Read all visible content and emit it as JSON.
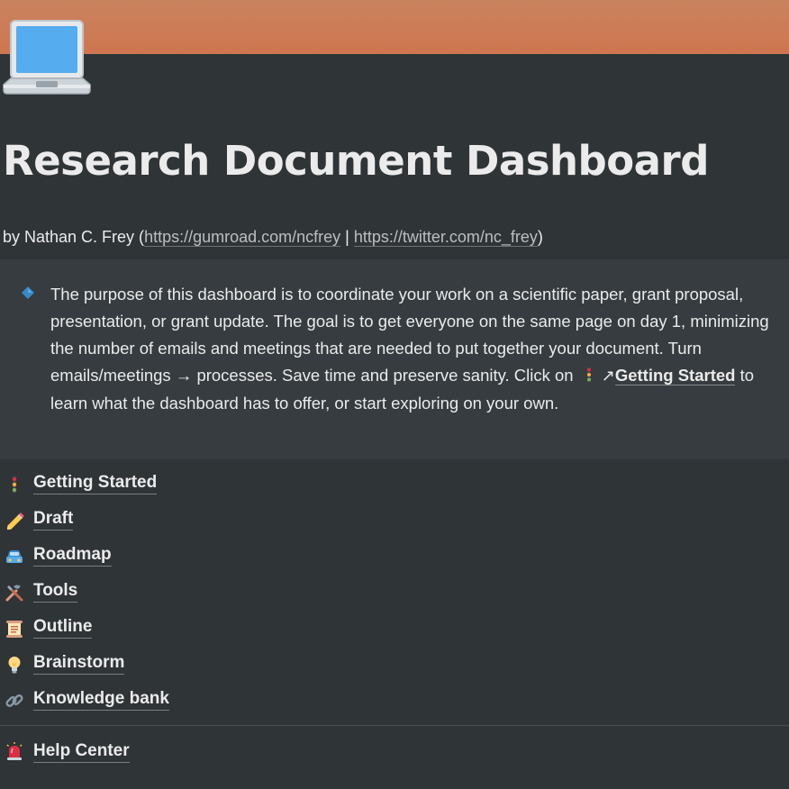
{
  "page": {
    "title": "Research Document Dashboard",
    "icon": "laptop-icon",
    "cover_colors": [
      "#c9835e",
      "#cf7650"
    ]
  },
  "byline": {
    "prefix": "by Nathan C. Frey (",
    "link1": "https://gumroad.com/ncfrey",
    "separator": " | ",
    "link2": "https://twitter.com/nc_frey",
    "suffix": ")"
  },
  "callout": {
    "icon": "diamond-icon",
    "text_before": "The purpose of this dashboard is to coordinate your work on a scientific paper, grant proposal, presentation, or grant update. The goal is to get everyone on the same page on day 1, minimizing the number of emails and meetings that are needed to put together your document. Turn emails/meetings → processes. Save time and preserve sanity. Click on ",
    "link_arrow": "↗",
    "link_label": "Getting Started",
    "text_after": " to learn what the dashboard has to offer, or start exploring on your own."
  },
  "links": [
    {
      "label": "Getting Started",
      "icon": "traffic-light-icon"
    },
    {
      "label": "Draft",
      "icon": "pencil-icon"
    },
    {
      "label": "Roadmap",
      "icon": "car-icon"
    },
    {
      "label": "Tools",
      "icon": "tools-icon"
    },
    {
      "label": "Outline",
      "icon": "scroll-icon"
    },
    {
      "label": "Brainstorm",
      "icon": "lightbulb-icon"
    },
    {
      "label": "Knowledge bank",
      "icon": "link-icon"
    }
  ],
  "help": {
    "label": "Help Center",
    "icon": "siren-icon"
  }
}
